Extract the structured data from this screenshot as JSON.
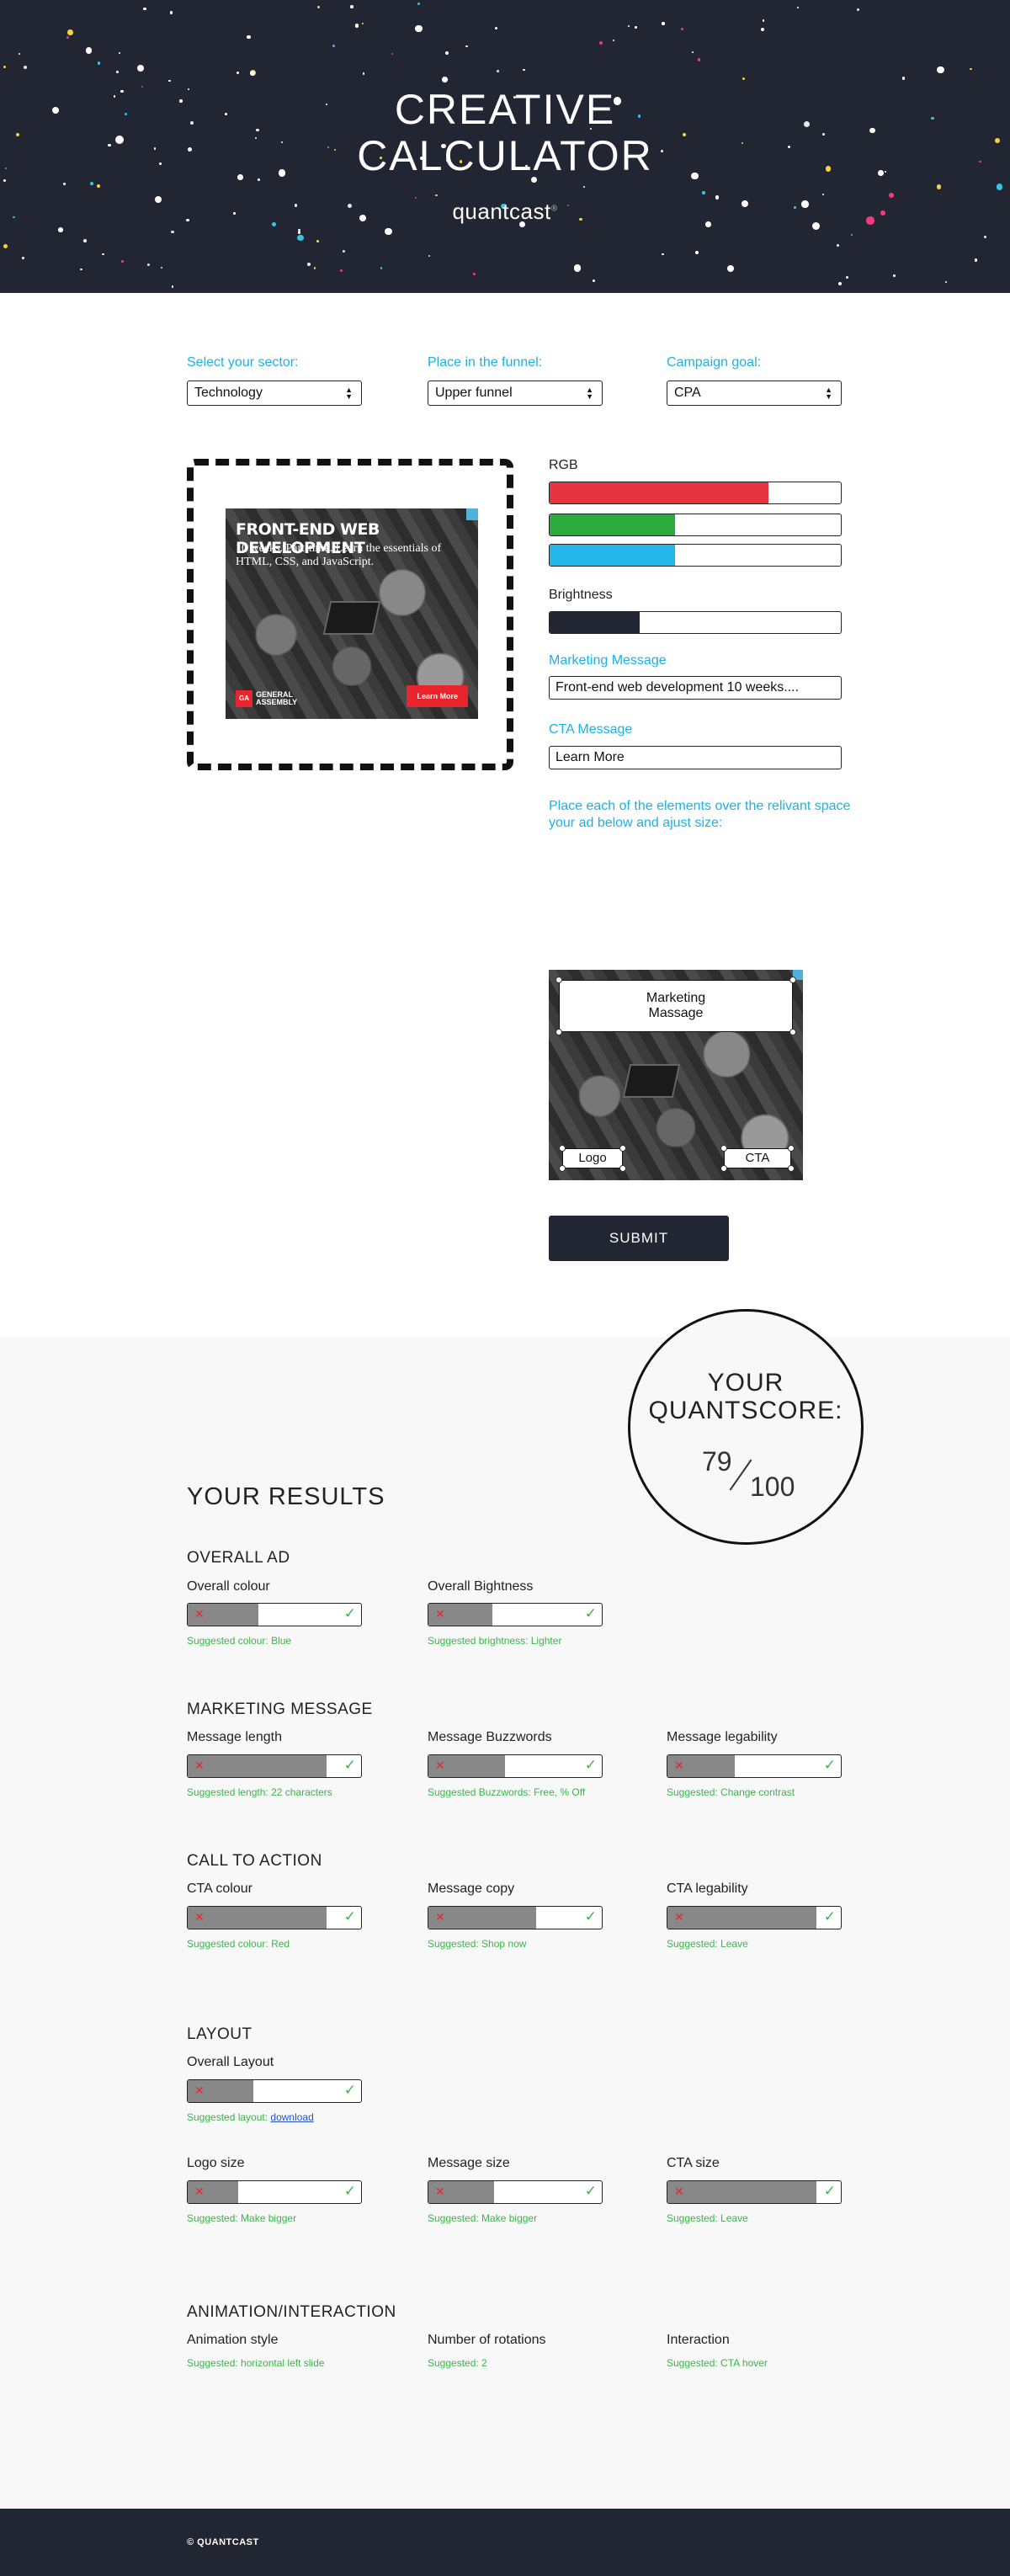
{
  "hero": {
    "title_line1": "CREATIVE",
    "title_line2": "CALCULATOR",
    "brand": "quantcast",
    "brand_mark": "®"
  },
  "selectors": [
    {
      "label": "Select your sector:",
      "value": "Technology"
    },
    {
      "label": "Place in the funnel:",
      "value": "Upper funnel"
    },
    {
      "label": "Campaign goal:",
      "value": "CPA"
    }
  ],
  "preview_ad": {
    "headline": "FRONT-END WEB DEVELOPMENT",
    "subtext": "10 weeks. Part-time. Learn the essentials of HTML, CSS, and JavaScript.",
    "logo_mark": "GA",
    "logo_text_1": "GENERAL",
    "logo_text_2": "ASSEMBLY",
    "cta": "Learn More"
  },
  "controls": {
    "rgb_label": "RGB",
    "rgb": [
      {
        "name": "red",
        "level": 0.75,
        "color": "#e63340"
      },
      {
        "name": "green",
        "level": 0.43,
        "color": "#2bab3c"
      },
      {
        "name": "blue",
        "level": 0.43,
        "color": "#23b7ea"
      }
    ],
    "brightness_label": "Brightness",
    "brightness": {
      "level": 0.31,
      "color": "#222632"
    },
    "marketing_label": "Marketing Message",
    "marketing_value": "Front-end web development 10 weeks....",
    "cta_label": "CTA Message",
    "cta_value": "Learn More",
    "instructions": "Place each of the elements over the relivant space your ad below and ajust size:"
  },
  "layout_ad": {
    "message_line1": "Marketing",
    "message_line2": "Massage",
    "logo": "Logo",
    "cta": "CTA"
  },
  "submit_label": "SUBMIT",
  "score": {
    "title_line1": "YOUR",
    "title_line2": "QUANTSCORE:",
    "value": "79",
    "max": "100"
  },
  "results": {
    "title": "YOUR RESULTS",
    "sections": {
      "overall_ad": {
        "title": "OVERALL AD",
        "metrics": [
          {
            "label": "Overall colour",
            "level": 0.41,
            "suggestion": "Suggested colour: Blue"
          },
          {
            "label": "Overall Bightness",
            "level": 0.37,
            "suggestion": "Suggested brightness: Lighter"
          }
        ]
      },
      "marketing": {
        "title": "MARKETING MESSAGE",
        "metrics": [
          {
            "label": "Message length",
            "level": 0.8,
            "suggestion": "Suggested length: 22 characters"
          },
          {
            "label": "Message Buzzwords",
            "level": 0.44,
            "suggestion": "Suggested Buzzwords: Free, % Off"
          },
          {
            "label": "Message legability",
            "level": 0.39,
            "suggestion": "Suggested: Change contrast"
          }
        ]
      },
      "cta": {
        "title": "CALL TO ACTION",
        "metrics": [
          {
            "label": "CTA colour",
            "level": 0.8,
            "suggestion": "Suggested colour: Red"
          },
          {
            "label": "Message copy",
            "level": 0.62,
            "suggestion": "Suggested: Shop now"
          },
          {
            "label": "CTA legability",
            "level": 0.86,
            "suggestion": "Suggested: Leave"
          }
        ]
      },
      "layout": {
        "title": "LAYOUT",
        "overall_label": "Overall Layout",
        "overall_level": 0.38,
        "overall_suggestion_prefix": "Suggested layout: ",
        "overall_suggestion_link": "download",
        "metrics": [
          {
            "label": "Logo size",
            "level": 0.29,
            "suggestion": "Suggested: Make bigger"
          },
          {
            "label": "Message size",
            "level": 0.38,
            "suggestion": "Suggested: Make bigger"
          },
          {
            "label": "CTA size",
            "level": 0.86,
            "suggestion": "Suggested: Leave"
          }
        ]
      },
      "animation": {
        "title": "ANIMATION/INTERACTION",
        "metrics": [
          {
            "label": "Animation style",
            "suggestion": "Suggested: horizontal left slide"
          },
          {
            "label": "Number of rotations",
            "suggestion": "Suggested: 2"
          },
          {
            "label": "Interaction",
            "suggestion": "Suggested: CTA hover"
          }
        ]
      }
    }
  },
  "footer": {
    "copyright": "© QUANTCAST"
  }
}
